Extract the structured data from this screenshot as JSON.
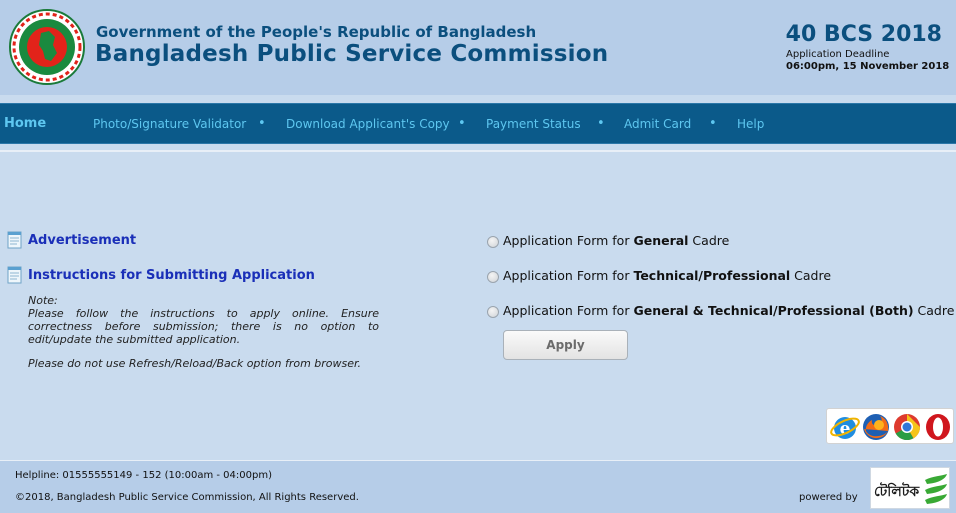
{
  "header": {
    "gov_title": "Government of the People's Republic of Bangladesh",
    "org_title": "Bangladesh Public Service Commission",
    "exam_title": "40 BCS 2018",
    "deadline_label": "Application Deadline",
    "deadline_value": "06:00pm, 15 November 2018",
    "seal_icon": "bangladesh-government-seal-icon"
  },
  "nav": {
    "home": "Home",
    "items": [
      "Photo/Signature Validator",
      "Download Applicant's Copy",
      "Payment Status",
      "Admit Card",
      "Help"
    ],
    "separator": "•"
  },
  "left": {
    "advertisement": "Advertisement",
    "instructions": "Instructions for Submitting Application",
    "note_label": "Note:",
    "note_body": "Please follow the instructions to apply online. Ensure correctness before submission; there is no option to edit/update the submitted application.",
    "note_warning": "Please do not use Refresh/Reload/Back option from browser."
  },
  "form": {
    "options": [
      {
        "prefix": "Application Form for ",
        "bold": "General",
        "suffix": " Cadre"
      },
      {
        "prefix": "Application Form for ",
        "bold": "Technical/Professional",
        "suffix": " Cadre"
      },
      {
        "prefix": "Application Form for ",
        "bold": "General & Technical/Professional (Both)",
        "suffix": " Cadre"
      }
    ],
    "apply_label": "Apply"
  },
  "browsers": [
    "internet-explorer-icon",
    "firefox-icon",
    "chrome-icon",
    "opera-icon"
  ],
  "footer": {
    "helpline": "Helpline: 01555555149 - 152 (10:00am - 04:00pm)",
    "copyright": "©2018, Bangladesh Public Service Commission, All Rights Reserved.",
    "powered_by": "powered by",
    "logo_text": "টেলিটক"
  },
  "colors": {
    "brand": "#0b4f7e",
    "nav_bg": "#0b5a8a",
    "nav_text": "#5ec7f0",
    "link": "#1a2fb8",
    "page_bg": "#c9dbee",
    "header_bg": "#b6cde8"
  }
}
